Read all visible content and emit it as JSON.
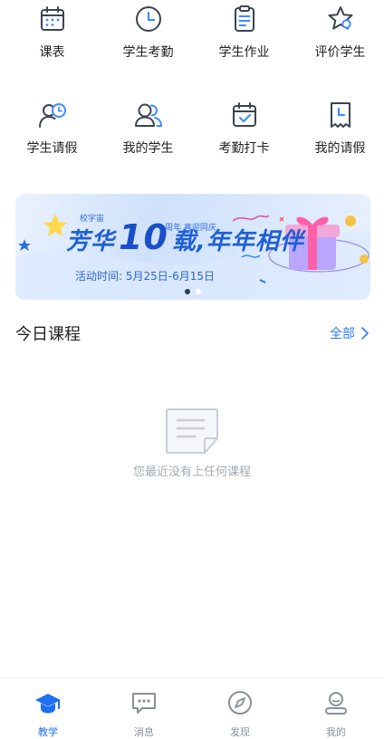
{
  "grid": [
    {
      "label": "课表",
      "icon": "calendar-icon"
    },
    {
      "label": "学生考勤",
      "icon": "clock-icon"
    },
    {
      "label": "学生作业",
      "icon": "clipboard-icon"
    },
    {
      "label": "评价学生",
      "icon": "star-icon"
    },
    {
      "label": "学生请假",
      "icon": "user-clock-icon"
    },
    {
      "label": "我的学生",
      "icon": "users-icon"
    },
    {
      "label": "考勤打卡",
      "icon": "calendar-check-icon"
    },
    {
      "label": "我的请假",
      "icon": "receipt-clock-icon"
    }
  ],
  "banner": {
    "tag": "校宇宙",
    "headline_left": "芳华",
    "number": "10",
    "headline_right": "载,年年相伴",
    "sub_tag": "周年  喜迎同庆",
    "date_text": "活动时间: 5月25日-6月15日",
    "slide_index": 1,
    "slide_count": 2
  },
  "section": {
    "title": "今日课程",
    "all_label": "全部"
  },
  "empty_state": {
    "text": "您最近没有上任何课程"
  },
  "tabbar": [
    {
      "label": "教学",
      "icon": "mortarboard-icon",
      "active": true
    },
    {
      "label": "消息",
      "icon": "message-icon",
      "active": false
    },
    {
      "label": "发现",
      "icon": "compass-icon",
      "active": false
    },
    {
      "label": "我的",
      "icon": "profile-icon",
      "active": false
    }
  ],
  "colors": {
    "accent": "#2d7cf6",
    "icon_stroke": "#3d4350",
    "icon_accent": "#3f8cff",
    "muted": "#a3a9b5"
  }
}
